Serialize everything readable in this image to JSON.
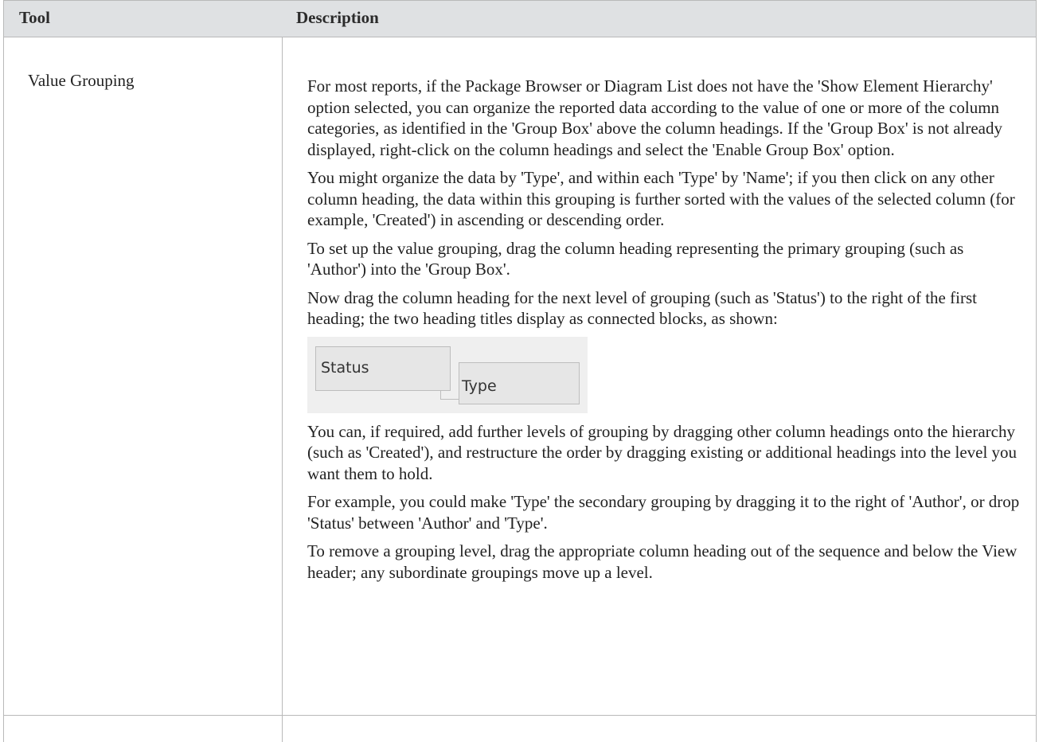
{
  "table": {
    "headers": {
      "tool": "Tool",
      "description": "Description"
    },
    "rows": [
      {
        "tool": "Value Grouping",
        "paragraphs": [
          "For most reports, if the Package Browser or Diagram List does not have the 'Show Element Hierarchy' option selected, you can organize the reported data according to the value of one or more of the column categories, as identified in the 'Group Box' above the column headings. If the 'Group Box' is not already displayed, right-click on the column headings and select the 'Enable Group Box' option.",
          "You might organize the data by 'Type', and within each 'Type' by 'Name'; if you then click on any other column heading, the data within this grouping is further sorted with the values of the selected column (for example, 'Created') in ascending or descending order.",
          "To set up the value grouping, drag the column heading representing the primary grouping (such as 'Author') into the 'Group Box'.",
          "Now drag the column heading for the next level of grouping (such as 'Status') to the right of the first heading; the two heading titles display as connected blocks, as shown:"
        ],
        "group_box_example": {
          "blocks": [
            "Status",
            "Type"
          ]
        },
        "paragraphs_after": [
          "You can, if required, add further levels of grouping by dragging other column headings onto the hierarchy (such as 'Created'), and restructure the order by dragging existing or additional headings into the level you want them to hold.",
          "For example, you could make 'Type' the secondary grouping by dragging it to the right of 'Author', or drop 'Status' between 'Author' and 'Type'.",
          "To remove a grouping level, drag the appropriate column heading out of the sequence and below the View header; any subordinate groupings move up a level."
        ]
      }
    ]
  }
}
